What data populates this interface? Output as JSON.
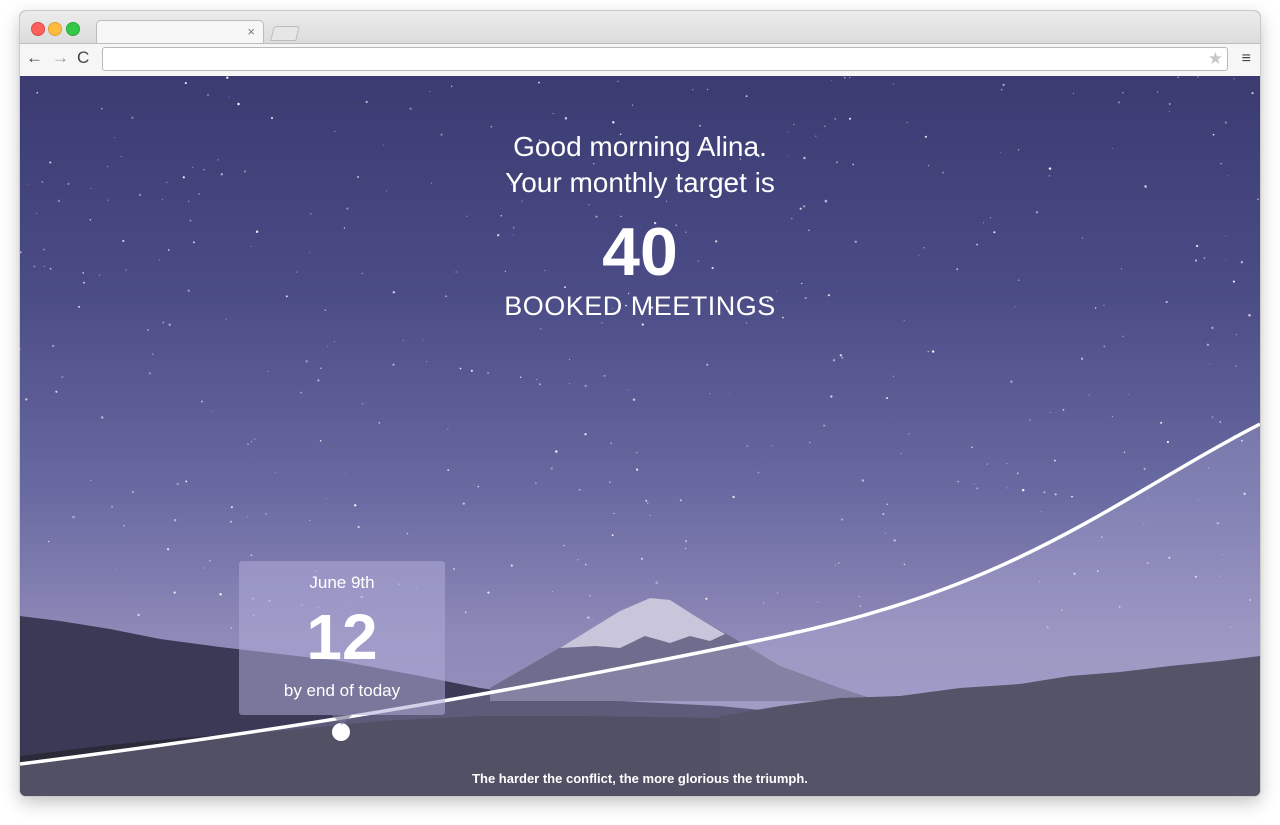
{
  "browser": {
    "tab": {
      "close_glyph": "×"
    },
    "toolbar": {
      "back_glyph": "←",
      "forward_glyph": "→",
      "reload_glyph": "C",
      "url_value": "",
      "star_glyph": "★",
      "menu_glyph": "≡"
    }
  },
  "dashboard": {
    "greeting_line1": "Good morning Alina.",
    "greeting_line2": "Your monthly target is",
    "target_number": "40",
    "target_label": "BOOKED MEETINGS",
    "daily": {
      "date": "June 9th",
      "number": "12",
      "caption": "by end of today"
    },
    "quote": "The harder the conflict, the more glorious the triumph."
  },
  "icons": [
    "back-icon",
    "forward-icon",
    "reload-icon",
    "bookmark-star-icon",
    "menu-icon",
    "close-icon"
  ],
  "colors": {
    "sky": "#4b4c86",
    "text": "#ffffff",
    "curve": "#ffffff",
    "card": "#afacd7"
  }
}
